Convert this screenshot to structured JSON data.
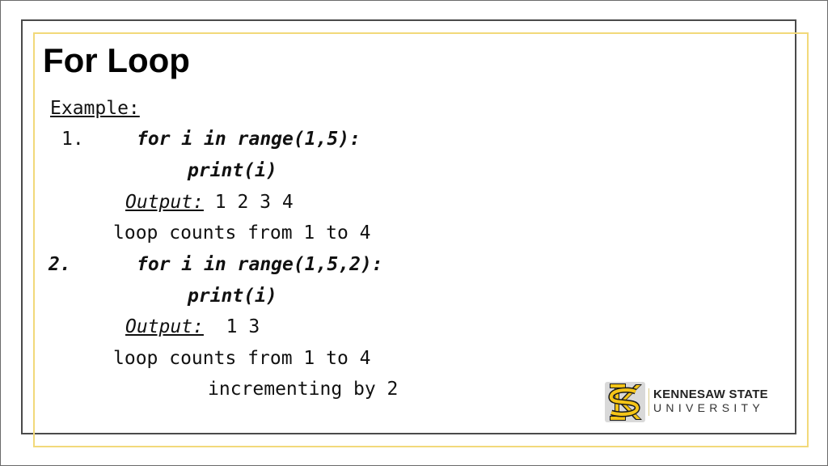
{
  "slide": {
    "title": "For Loop",
    "example_label": "Example:",
    "example1": {
      "number": "1.",
      "code_line1": "for i in range(1,5):",
      "code_line2": "print(i)",
      "output_label": "Output:",
      "output_value": "1 2 3 4",
      "explanation": "loop counts from 1 to 4"
    },
    "example2": {
      "number": "2.",
      "code_line1": "for i in range(1,5,2):",
      "code_line2": "print(i)",
      "output_label": "Output:",
      "output_value": "1 3",
      "explanation_line1": "loop counts from 1 to 4",
      "explanation_line2": "incrementing by 2"
    }
  },
  "logo": {
    "icon": "ks-monogram-icon",
    "line1": "KENNESAW STATE",
    "line2": "UNIVERSITY",
    "colors": {
      "gold": "#f5c518",
      "black": "#1a1a1a",
      "gray": "#c8c8c8"
    }
  },
  "colors": {
    "frame_dark": "#4a4a4a",
    "frame_gold": "#f2d97a"
  }
}
